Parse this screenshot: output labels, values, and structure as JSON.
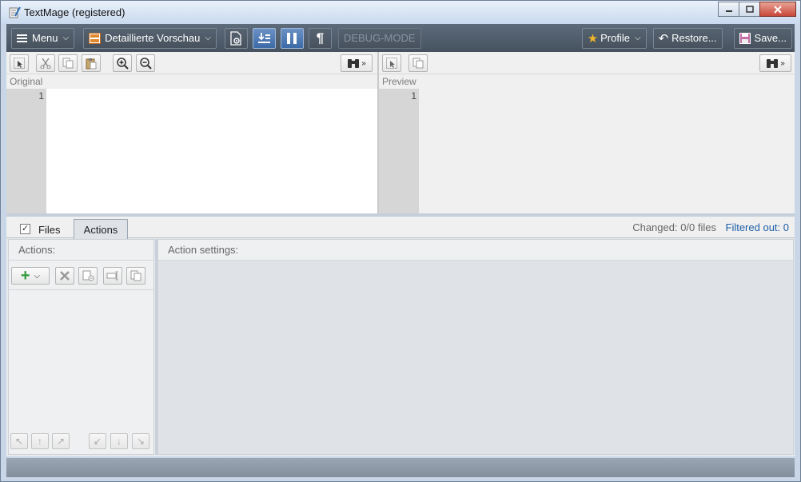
{
  "window": {
    "title": "TextMage (registered)"
  },
  "toolbar": {
    "menu_label": "Menu",
    "view_label": "Detaillierte Vorschau",
    "debug_label": "DEBUG-MODE",
    "profile_label": "Profile",
    "restore_label": "Restore...",
    "save_label": "Save..."
  },
  "original_pane": {
    "label": "Original",
    "line_number": "1"
  },
  "preview_pane": {
    "label": "Preview",
    "line_number": "1"
  },
  "bottom": {
    "files_tab": "Files",
    "actions_tab": "Actions",
    "changed": "Changed: 0/0 files",
    "filtered": "Filtered out: 0",
    "actions_label": "Actions:",
    "action_settings_label": "Action settings:"
  },
  "colors": {
    "toolbar_bg": "#4f5b68",
    "toggle_on": "#4f7ab4",
    "link_blue": "#1f5fa8"
  }
}
